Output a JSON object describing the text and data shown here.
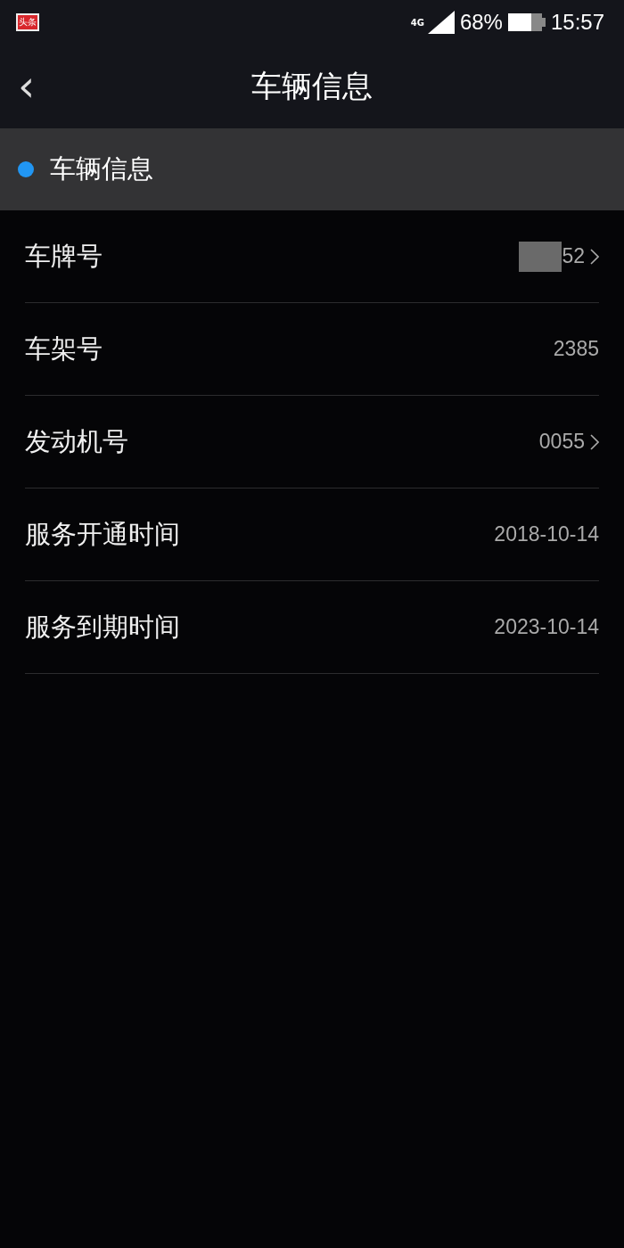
{
  "status_bar": {
    "app_badge": "头条",
    "network": "4G",
    "battery": "68%",
    "time": "15:57"
  },
  "header": {
    "back": "‹",
    "title": "车辆信息"
  },
  "section": {
    "title": "车辆信息",
    "color": "#2196f3"
  },
  "rows": [
    {
      "label": "车牌号",
      "value": "52",
      "chevron": true,
      "redacted": true
    },
    {
      "label": "车架号",
      "value": "2385",
      "chevron": false,
      "redacted": false
    },
    {
      "label": "发动机号",
      "value": "0055",
      "chevron": true,
      "redacted": false
    },
    {
      "label": "服务开通时间",
      "value": "2018-10-14",
      "chevron": false,
      "redacted": false
    },
    {
      "label": "服务到期时间",
      "value": "2023-10-14",
      "chevron": false,
      "redacted": false
    }
  ]
}
